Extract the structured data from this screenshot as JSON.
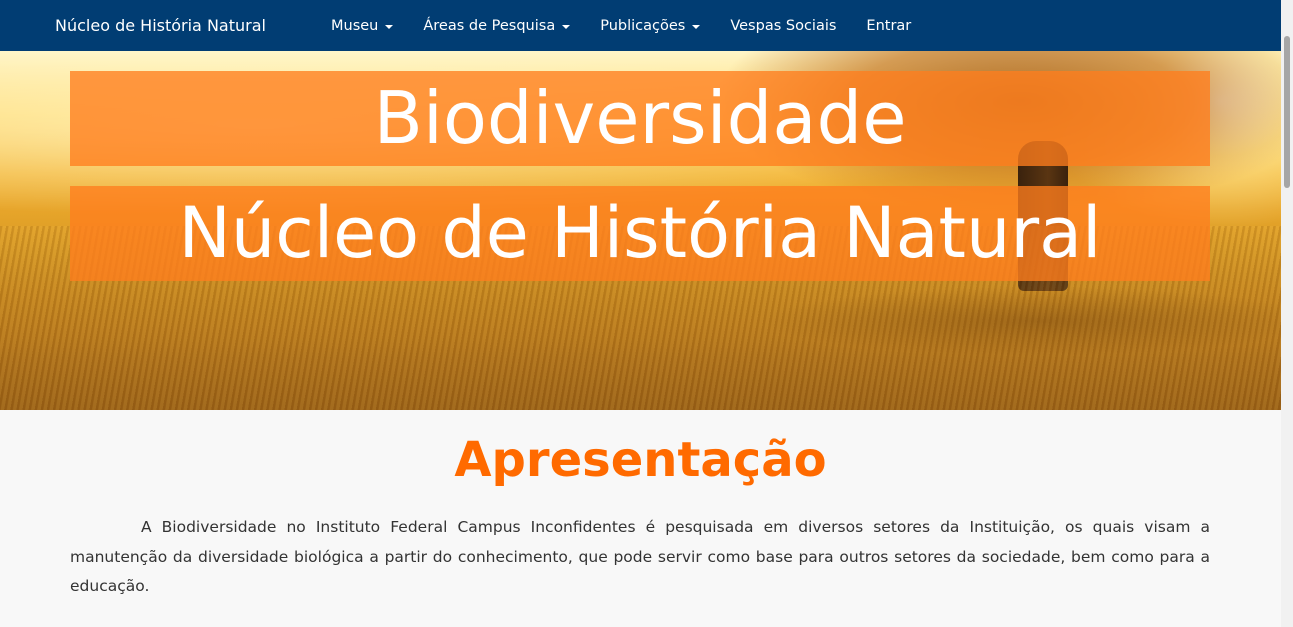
{
  "nav": {
    "brand": "Núcleo de História Natural",
    "items": [
      {
        "label": "Museu",
        "dropdown": true
      },
      {
        "label": "Áreas de Pesquisa",
        "dropdown": true
      },
      {
        "label": "Publicações",
        "dropdown": true
      },
      {
        "label": "Vespas Sociais",
        "dropdown": false
      },
      {
        "label": "Entrar",
        "dropdown": false
      }
    ]
  },
  "hero": {
    "line1": "Biodiversidade",
    "line2": "Núcleo de História Natural"
  },
  "section": {
    "title": "Apresentação",
    "paragraph": "A Biodiversidade no Instituto Federal Campus Inconfidentes é pesquisada em diversos setores da Instituição, os quais visam a manutenção da diversidade biológica a partir do conhecimento, que pode servir como base para outros setores da sociedade, bem como para a educação."
  },
  "colors": {
    "navbar": "#013d73",
    "banner": "#ff7d1e",
    "title": "#ff6a00",
    "text": "#333333"
  }
}
